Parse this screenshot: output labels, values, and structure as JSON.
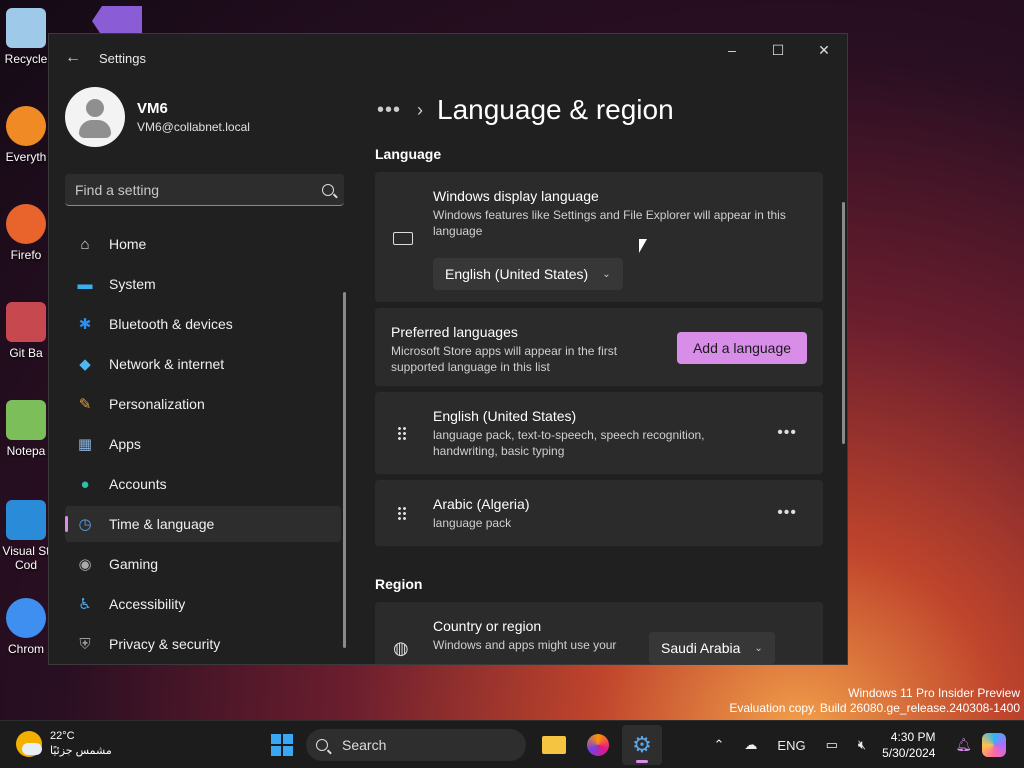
{
  "desktop": {
    "icons": [
      {
        "label": "Recycle",
        "color": "#9ec9e8"
      },
      {
        "label": "Everyth",
        "color": "#f08a24"
      },
      {
        "label": "Firefo",
        "color": "#e8642c"
      },
      {
        "label": "Git Ba",
        "color": "#c7484f"
      },
      {
        "label": "Notepa",
        "color": "#7cbf5a"
      },
      {
        "label": "Visual St Cod",
        "color": "#2a8cd8"
      },
      {
        "label": "Chrom",
        "color": "#3f8ff0"
      }
    ]
  },
  "window": {
    "title": "Settings",
    "controls": {
      "minimize": "–",
      "maximize": "☐",
      "close": "✕"
    }
  },
  "profile": {
    "name": "VM6",
    "email": "VM6@collabnet.local"
  },
  "search": {
    "placeholder": "Find a setting"
  },
  "nav": [
    {
      "label": "Home",
      "icon": "home-icon",
      "glyph": "⌂",
      "color": "#d9d9d9"
    },
    {
      "label": "System",
      "icon": "system-icon",
      "glyph": "▬",
      "color": "#3ab0f0"
    },
    {
      "label": "Bluetooth & devices",
      "icon": "bluetooth-icon",
      "glyph": "✱",
      "color": "#2f8fe8"
    },
    {
      "label": "Network & internet",
      "icon": "network-icon",
      "glyph": "◆",
      "color": "#4fb6f2"
    },
    {
      "label": "Personalization",
      "icon": "brush-icon",
      "glyph": "✎",
      "color": "#e89a3c"
    },
    {
      "label": "Apps",
      "icon": "apps-icon",
      "glyph": "▦",
      "color": "#8fb3d9"
    },
    {
      "label": "Accounts",
      "icon": "accounts-icon",
      "glyph": "●",
      "color": "#2fc0a8"
    },
    {
      "label": "Time & language",
      "icon": "time-language-icon",
      "glyph": "◷",
      "color": "#5aa0e8",
      "active": true
    },
    {
      "label": "Gaming",
      "icon": "gaming-icon",
      "glyph": "◉",
      "color": "#aaaaaa"
    },
    {
      "label": "Accessibility",
      "icon": "accessibility-icon",
      "glyph": "♿",
      "color": "#4fa8ea"
    },
    {
      "label": "Privacy & security",
      "icon": "shield-icon",
      "glyph": "⛨",
      "color": "#9a9a9a"
    }
  ],
  "main": {
    "breadcrumb_dots": "•••",
    "breadcrumb_sep": "›",
    "title": "Language & region",
    "language_section": "Language",
    "display_language": {
      "title": "Windows display language",
      "subtitle": "Windows features like Settings and File Explorer will appear in this language",
      "value": "English (United States)"
    },
    "preferred": {
      "title": "Preferred languages",
      "subtitle": "Microsoft Store apps will appear in the first supported language in this list",
      "add_label": "Add a language"
    },
    "languages": [
      {
        "name": "English (United States)",
        "detail": "language pack, text-to-speech, speech recognition, handwriting, basic typing"
      },
      {
        "name": "Arabic (Algeria)",
        "detail": "language pack"
      }
    ],
    "region_section": "Region",
    "country": {
      "title": "Country or region",
      "subtitle": "Windows and apps might use your",
      "value": "Saudi Arabia"
    }
  },
  "watermark": {
    "line1": "Windows 11 Pro Insider Preview",
    "line2": "Evaluation copy. Build 26080.ge_release.240308-1400"
  },
  "taskbar": {
    "weather_temp": "22°C",
    "weather_desc": "مشمس جزئيًا",
    "search_label": "Search",
    "tray_lang": "ENG",
    "time": "4:30 PM",
    "date": "5/30/2024"
  },
  "colors": {
    "accent": "#d88de8",
    "window_bg": "#202020",
    "card_bg": "#2b2b2b"
  }
}
